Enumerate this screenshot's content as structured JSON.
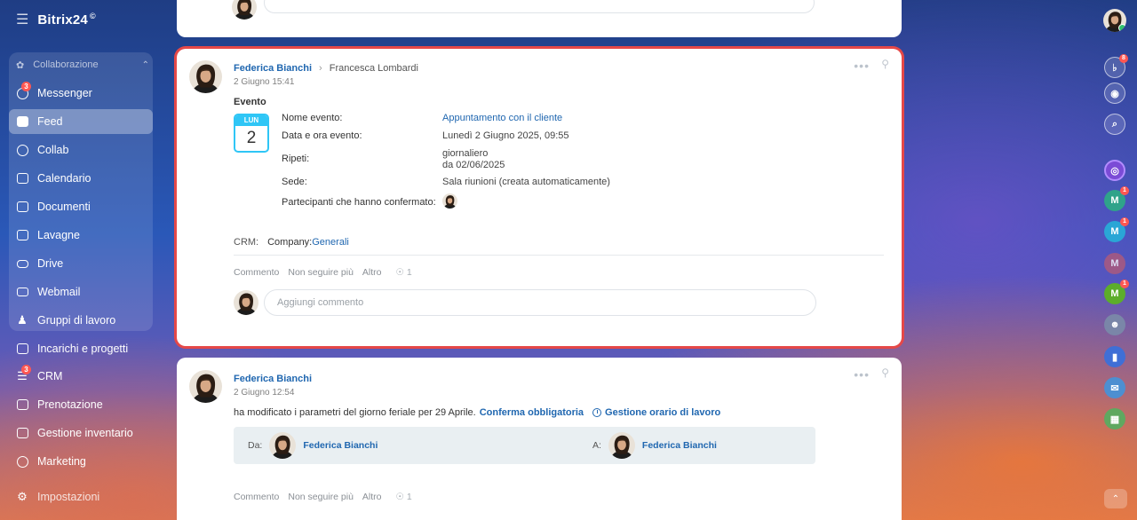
{
  "app": {
    "brand": "Bitrix24",
    "brand_mark": "©"
  },
  "sidebar": {
    "group_label": "Collaborazione",
    "items": [
      {
        "label": "Messenger",
        "icon": "chat-icon",
        "badge": "3"
      },
      {
        "label": "Feed",
        "icon": "feed-icon",
        "active": true
      },
      {
        "label": "Collab",
        "icon": "collab-icon"
      },
      {
        "label": "Calendario",
        "icon": "calendar-icon"
      },
      {
        "label": "Documenti",
        "icon": "document-icon"
      },
      {
        "label": "Lavagne",
        "icon": "whiteboard-icon"
      },
      {
        "label": "Drive",
        "icon": "drive-icon"
      },
      {
        "label": "Webmail",
        "icon": "mail-icon"
      },
      {
        "label": "Gruppi di lavoro",
        "icon": "groups-icon"
      },
      {
        "label": "Incarichi e progetti",
        "icon": "tasks-icon"
      },
      {
        "label": "CRM",
        "icon": "crm-icon",
        "badge": "3"
      },
      {
        "label": "Prenotazione",
        "icon": "booking-icon"
      },
      {
        "label": "Gestione inventario",
        "icon": "inventory-icon"
      },
      {
        "label": "Marketing",
        "icon": "marketing-icon"
      }
    ],
    "settings_label": "Impostazioni"
  },
  "post_event": {
    "author": "Federica Bianchi",
    "recipient": "Francesca Lombardi",
    "date": "2 Giugno 15:41",
    "type_label": "Evento",
    "calendar": {
      "weekday": "LUN",
      "day": "2"
    },
    "labels": {
      "name": "Nome evento:",
      "datetime": "Data e ora evento:",
      "repeat": "Ripeti:",
      "place": "Sede:",
      "participants": "Partecipanti che hanno confermato:"
    },
    "values": {
      "name": "Appuntamento con il cliente",
      "datetime": "Lunedì 2 Giugno 2025, 09:55",
      "repeat_1": "giornaliero",
      "repeat_2": "da 02/06/2025",
      "place": "Sala riunioni (creata automaticamente)"
    },
    "crm_label": "CRM:",
    "crm_company": "Company:",
    "crm_link": "Generali",
    "actions": {
      "comment": "Commento",
      "unfollow": "Non seguire più",
      "more": "Altro",
      "views": "1"
    },
    "comment_placeholder": "Aggiungi commento"
  },
  "post_second": {
    "author": "Federica Bianchi",
    "date": "2 Giugno 12:54",
    "text": "ha modificato i parametri del giorno feriale per 29 Aprile.",
    "link_confirm": "Conferma obbligatoria",
    "link_schedule": "Gestione orario di lavoro",
    "from_label": "Da:",
    "from_name": "Federica Bianchi",
    "to_label": "A:",
    "to_name": "Federica Bianchi",
    "actions": {
      "comment": "Commento",
      "unfollow": "Non seguire più",
      "more": "Altro",
      "views": "1"
    }
  },
  "right_panel": {
    "notifications_badge": "8",
    "m1_badge": "1",
    "m2_badge": "1",
    "m4_badge": "1",
    "m_letter": "M"
  }
}
